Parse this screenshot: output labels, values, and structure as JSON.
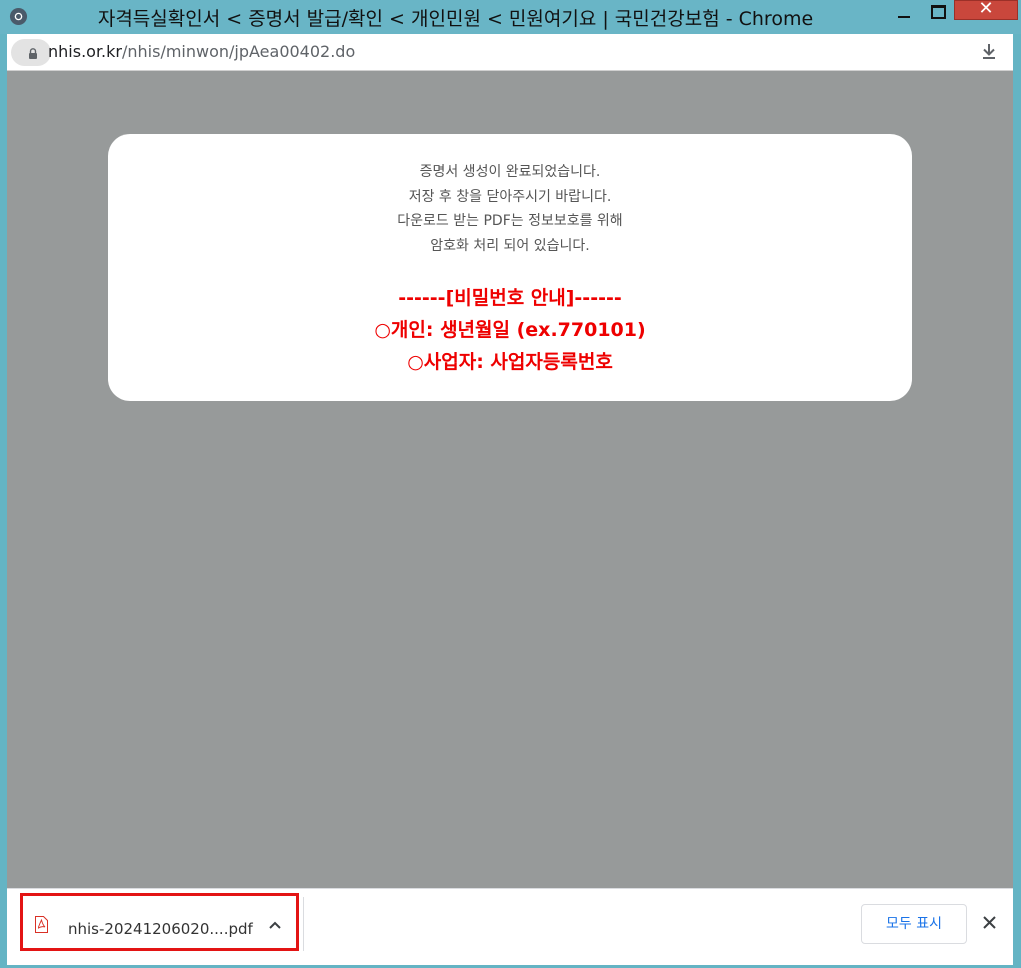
{
  "window": {
    "title": "자격득실확인서 < 증명서 발급/확인 < 개인민원 < 민원여기요 | 국민건강보험 - Chrome",
    "close_label": "✕"
  },
  "address": {
    "domain": "nhis.or.kr",
    "path": "/nhis/minwon/jpAea00402.do"
  },
  "modal": {
    "messages": [
      "증명서 생성이 완료되었습니다.",
      "저장 후 창을 닫아주시기 바랍니다.",
      "다운로드 받는 PDF는 정보보호를 위해",
      "암호화 처리 되어 있습니다."
    ],
    "password": {
      "heading": "------[비밀번호 안내]------",
      "personal": "○개인: 생년월일 (ex.770101)",
      "business": "○사업자: 사업자등록번호"
    }
  },
  "downloads": {
    "file_name": "nhis-20241206020....pdf",
    "show_all_label": "모두 표시"
  },
  "colors": {
    "title_bar": "#69b5c6",
    "page_overlay": "#979a9a",
    "password_text": "#ee0000",
    "highlight_border": "#e31414",
    "link_blue": "#1a73e8"
  },
  "icons": [
    "chrome-app-icon",
    "lock-icon",
    "download-icon",
    "pdf-file-icon",
    "chevron-up-icon",
    "close-icon"
  ]
}
